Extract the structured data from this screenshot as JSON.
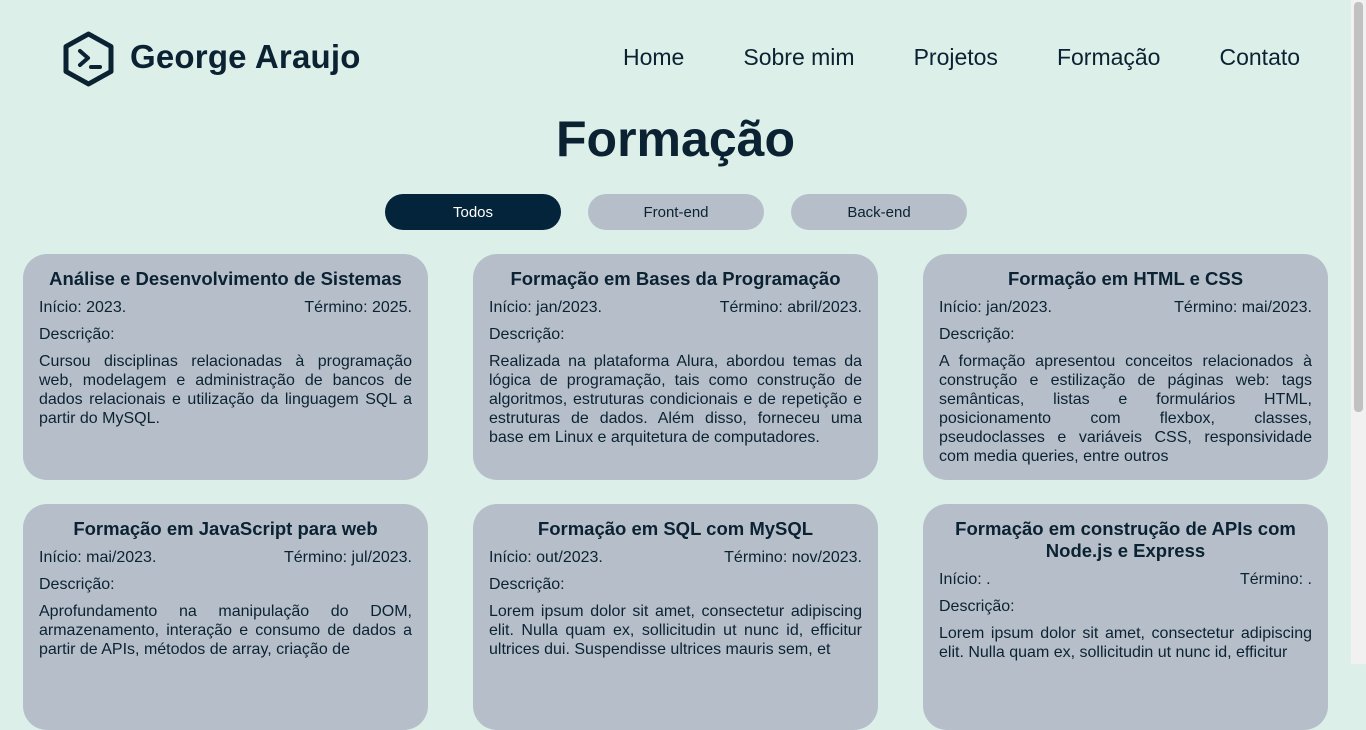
{
  "header": {
    "brand": "George Araujo",
    "nav": [
      "Home",
      "Sobre mim",
      "Projetos",
      "Formação",
      "Contato"
    ]
  },
  "page": {
    "title": "Formação"
  },
  "filters": {
    "items": [
      "Todos",
      "Front-end",
      "Back-end"
    ],
    "active": "Todos"
  },
  "labels": {
    "description": "Descrição:"
  },
  "cards": [
    {
      "title": "Análise e Desenvolvimento de Sistemas",
      "start": "Início: 2023.",
      "end": "Término: 2025.",
      "description": "Cursou disciplinas relacionadas à programação web, modelagem e administração de bancos de dados relacionais e utilização da linguagem SQL a partir do MySQL."
    },
    {
      "title": "Formação em Bases da Programação",
      "start": "Início: jan/2023.",
      "end": "Término: abril/2023.",
      "description": "Realizada na plataforma Alura, abordou temas da lógica de programação, tais como construção de algoritmos, estruturas condicionais e de repetição e estruturas de dados. Além disso, forneceu uma base em Linux e arquitetura de computadores."
    },
    {
      "title": "Formação em HTML e CSS",
      "start": "Início: jan/2023.",
      "end": "Término: mai/2023.",
      "description": "A formação apresentou conceitos relacionados à construção e estilização de páginas web: tags semânticas, listas e formulários HTML, posicionamento com flexbox, classes, pseudoclasses e variáveis CSS, responsividade com media queries, entre outros"
    },
    {
      "title": "Formação em JavaScript para web",
      "start": "Início: mai/2023.",
      "end": "Término: jul/2023.",
      "description": "Aprofundamento na manipulação do DOM, armazenamento, interação e consumo de dados a partir de APIs, métodos de array, criação de"
    },
    {
      "title": "Formação em SQL com MySQL",
      "start": "Início: out/2023.",
      "end": "Término: nov/2023.",
      "description": "Lorem ipsum dolor sit amet, consectetur adipiscing elit. Nulla quam ex, sollicitudin ut nunc id, efficitur ultrices dui. Suspendisse ultrices mauris sem, et"
    },
    {
      "title": "Formação em construção de APIs com Node.js e Express",
      "start": "Início: .",
      "end": "Término: .",
      "description": "Lorem ipsum dolor sit amet, consectetur adipiscing elit. Nulla quam ex, sollicitudin ut nunc id, efficitur"
    }
  ],
  "colors": {
    "background": "#dcefe8",
    "primary": "#03243a",
    "card": "#b6bfc9"
  },
  "icons": {
    "logo": "terminal-hexagon-icon"
  }
}
